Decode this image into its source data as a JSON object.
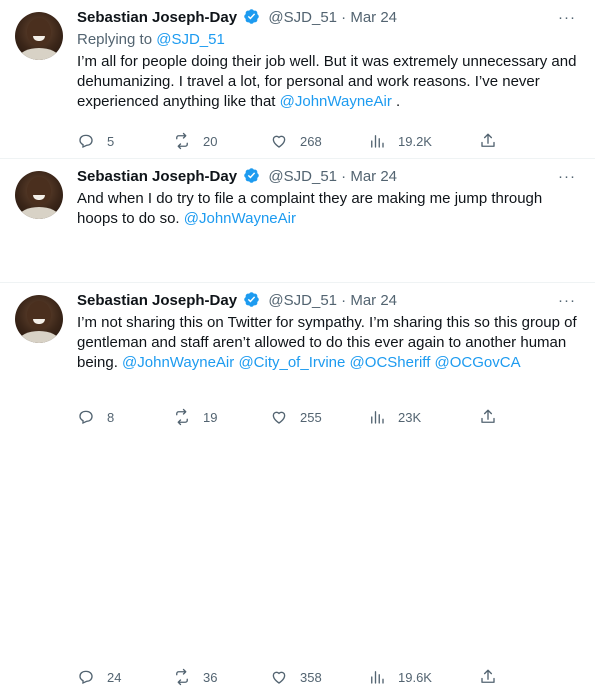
{
  "tweets": [
    {
      "author": "Sebastian Joseph-Day",
      "handle": "@SJD_51",
      "separator": "·",
      "date": "Mar 24",
      "more": "···",
      "replying_prefix": "Replying to ",
      "replying_handle": "@SJD_51",
      "text": "I’m all for people doing their job well. But it was extremely unnecessary and dehumanizing. I travel a lot, for personal and work reasons. I’ve never experienced anything like that ",
      "mentions": [
        "@JohnWayneAir"
      ],
      "text_suffix": " .",
      "stats": {
        "replies": "5",
        "retweets": "20",
        "likes": "268",
        "views": "19.2K"
      }
    },
    {
      "author": "Sebastian Joseph-Day",
      "handle": "@SJD_51",
      "separator": "·",
      "date": "Mar 24",
      "more": "···",
      "text": "And when I do try to file a complaint they are making me jump through hoops to do so. ",
      "mentions": [
        "@JohnWayneAir"
      ],
      "stats": {
        "replies": "8",
        "retweets": "19",
        "likes": "255",
        "views": "23K"
      }
    },
    {
      "author": "Sebastian Joseph-Day",
      "handle": "@SJD_51",
      "separator": "·",
      "date": "Mar 24",
      "more": "···",
      "text": "I’m not sharing this on Twitter for sympathy. I’m sharing this so this group of gentleman and staff aren’t allowed to do this ever again to another human being. ",
      "mentions": [
        "@JohnWayneAir",
        "@City_of_Irvine",
        "@OCSheriff",
        "@OCGovCA"
      ],
      "stats": {
        "replies": "24",
        "retweets": "36",
        "likes": "358",
        "views": "19.6K"
      }
    }
  ],
  "colors": {
    "link": "#1d9bf0",
    "verified": "#1d9bf0",
    "muted": "#536471",
    "text": "#0f1419"
  },
  "icons": [
    "reply-icon",
    "retweet-icon",
    "like-icon",
    "views-icon",
    "share-icon",
    "verified-icon",
    "more-icon"
  ]
}
